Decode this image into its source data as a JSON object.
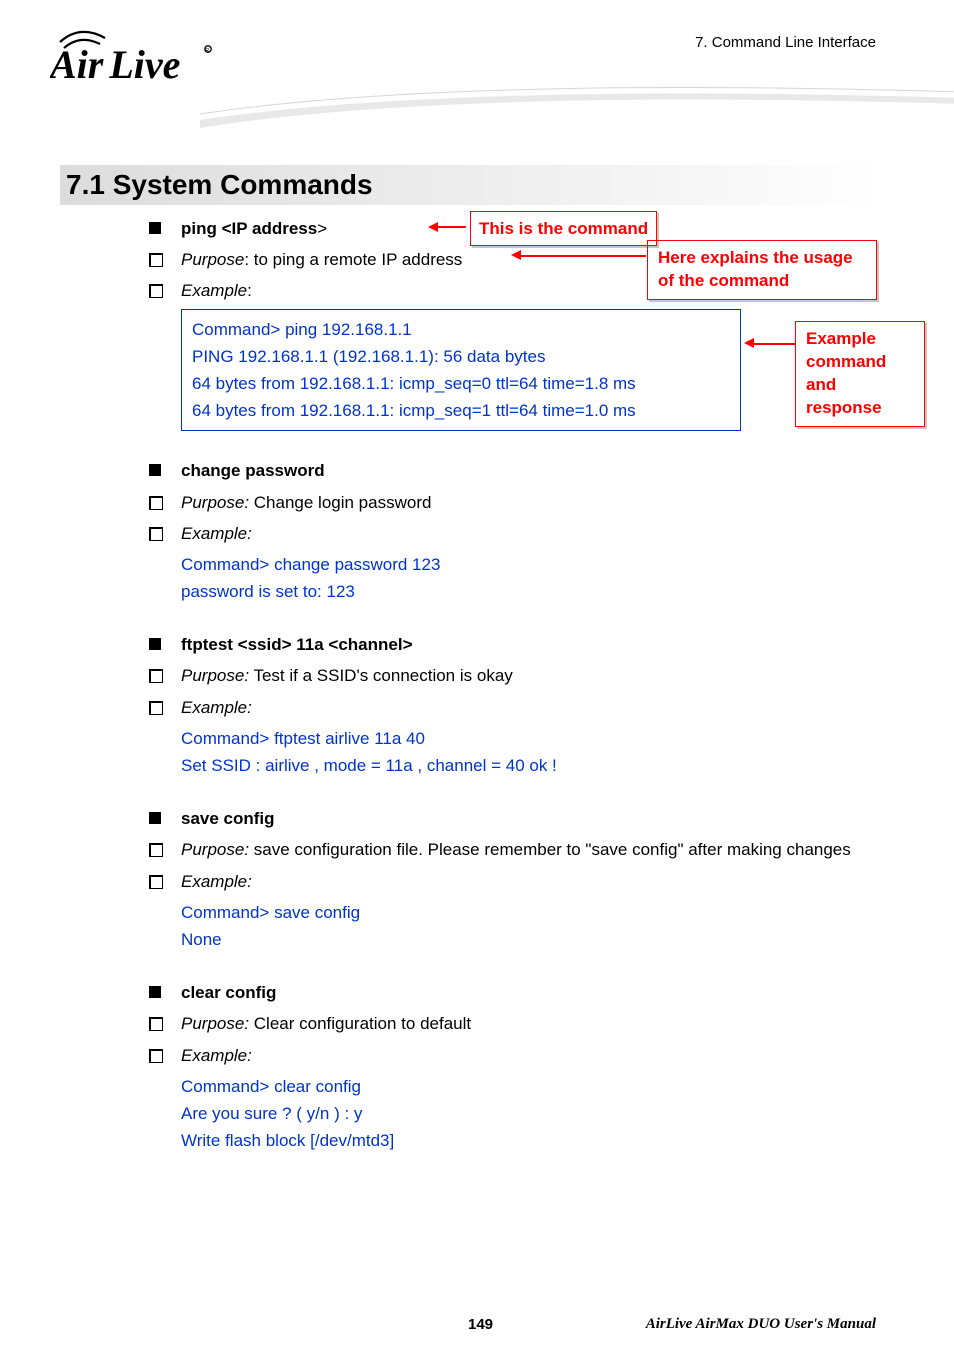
{
  "header": {
    "chapter": "7.  Command  Line  Interface",
    "logo_text_air": "Air",
    "logo_text_live": "Live"
  },
  "section": {
    "heading": "7.1 System  Commands"
  },
  "callouts": {
    "this_is_command": "This is the command",
    "here_explains_l1": "Here explains the usage",
    "here_explains_l2": "of the command",
    "example_l1": "Example",
    "example_l2": "command and",
    "example_l3": "response"
  },
  "cmd_ping": {
    "title_prefix": "ping <IP address",
    "title_suffix": ">",
    "purpose_label": "Purpose",
    "purpose_text": ": to ping a remote IP address",
    "example_label": "Example",
    "example_colon": ":",
    "out_l1": "Command> ping 192.168.1.1",
    "out_l2": "PING 192.168.1.1 (192.168.1.1): 56 data bytes",
    "out_l3": "64 bytes from 192.168.1.1: icmp_seq=0 ttl=64 time=1.8 ms",
    "out_l4": "64 bytes from 192.168.1.1: icmp_seq=1 ttl=64 time=1.0 ms"
  },
  "cmd_changepw": {
    "title": "change password",
    "purpose_label": "Purpose:",
    "purpose_text": " Change login password",
    "example_label": "Example:",
    "out_l1": "Command> change password 123",
    "out_l2": "password is set to: 123"
  },
  "cmd_ftptest": {
    "title": "ftptest <ssid> 11a <channel>",
    "purpose_label": "Purpose:",
    "purpose_text": "   Test if a SSID's connection is okay",
    "example_label": "Example:",
    "out_l1": "Command> ftptest    airlive 11a 40",
    "out_l2": "Set SSID : airlive , mode = 11a , channel = 40 ok !"
  },
  "cmd_saveconfig": {
    "title": "save config",
    "purpose_label": "Purpose:",
    "purpose_text": "   save configuration file.    Please remember to \"save config\" after making changes",
    "example_label": "Example:",
    "out_l1": "Command> save config",
    "out_l2": "None"
  },
  "cmd_clearconfig": {
    "title": "clear config",
    "purpose_label": "Purpose:",
    "purpose_text": "   Clear configuration to default",
    "example_label": "Example:",
    "out_l1": "Command> clear config",
    "out_l2": "Are you sure ? ( y/n ) : y",
    "out_l3": "Write flash block [/dev/mtd3]"
  },
  "footer": {
    "page_number": "149",
    "manual_title": "AirLive  AirMax  DUO  User's  Manual"
  }
}
